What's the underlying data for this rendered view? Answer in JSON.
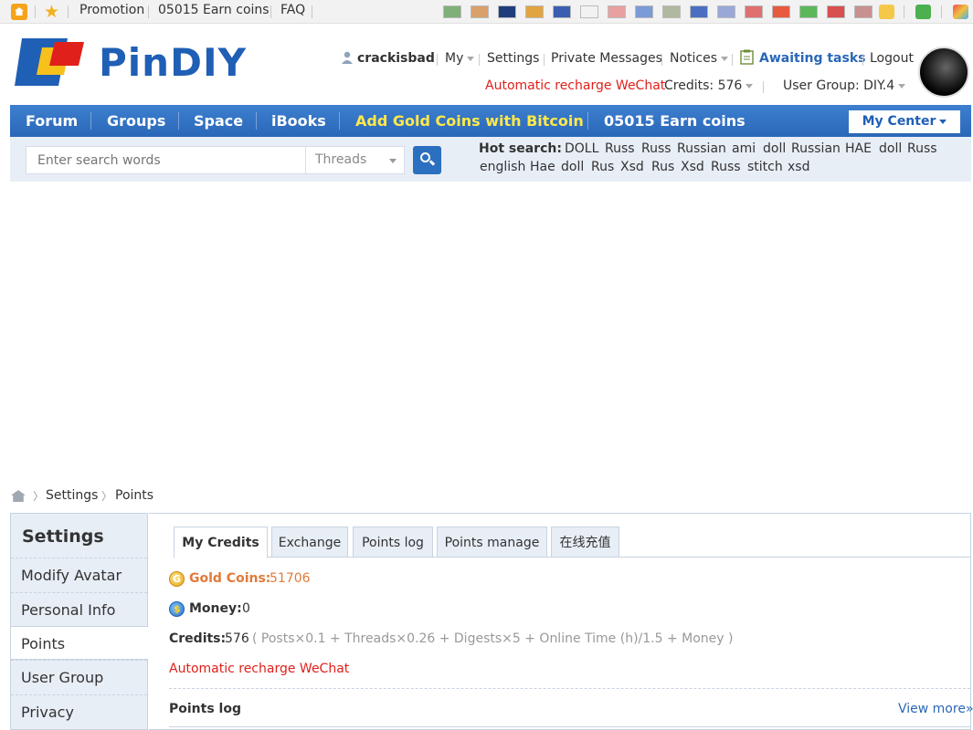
{
  "topbar": {
    "links": [
      "Promotion",
      "05015 Earn coins",
      "FAQ"
    ],
    "icons": [
      "home-icon",
      "star-icon",
      "glasses-icon",
      "recycle-icon",
      "app-icon"
    ],
    "flags": [
      {
        "name": "flag-icon",
        "color": "#7fb07a"
      },
      {
        "name": "flag-icon",
        "color": "#d9a06a"
      },
      {
        "name": "flag-icon",
        "color": "#1f3d7a"
      },
      {
        "name": "flag-icon",
        "color": "#e2a440"
      },
      {
        "name": "flag-icon",
        "color": "#3a5fb0"
      },
      {
        "name": "flag-icon",
        "color": "#f2f2f2"
      },
      {
        "name": "flag-icon",
        "color": "#e8a0a0"
      },
      {
        "name": "flag-icon",
        "color": "#7a9ad8"
      },
      {
        "name": "flag-icon",
        "color": "#b0b8a0"
      },
      {
        "name": "flag-icon",
        "color": "#4a6fc0"
      },
      {
        "name": "flag-icon",
        "color": "#9aa8d8"
      },
      {
        "name": "flag-icon",
        "color": "#e07070"
      },
      {
        "name": "flag-icon",
        "color": "#e85a40"
      },
      {
        "name": "flag-icon",
        "color": "#5ab85a"
      },
      {
        "name": "flag-icon",
        "color": "#d85050"
      },
      {
        "name": "flag-icon",
        "color": "#c89090"
      }
    ]
  },
  "header": {
    "logo_text": "PinDIY",
    "username": "crackisbad",
    "my_label": "My",
    "settings_label": "Settings",
    "pm_label": "Private Messages",
    "notices_label": "Notices",
    "tasks_label": "Awaiting tasks",
    "logout_label": "Logout",
    "recharge_label": "Automatic recharge WeChat",
    "credits_label": "Credits: 576",
    "usergroup_label": "User Group: DIY.4"
  },
  "nav": {
    "items": [
      "Forum",
      "Groups",
      "Space",
      "iBooks",
      "Add Gold Coins with Bitcoin",
      "05015 Earn coins"
    ],
    "my_center": "My Center"
  },
  "search": {
    "placeholder": "Enter search words",
    "type": "Threads",
    "hot_label": "Hot search:",
    "hot_words": [
      "DOLL",
      "Russ",
      "Russ",
      "Russian",
      "ami",
      "doll",
      "Russian",
      "HAE",
      "doll",
      "Russ",
      "english",
      "Hae",
      "doll",
      "Rus",
      "Xsd",
      "Rus",
      "Xsd",
      "Russ",
      "stitch",
      "xsd"
    ]
  },
  "breadcrumb": [
    "Settings",
    "Points"
  ],
  "sidebar": {
    "title": "Settings",
    "items": [
      "Modify Avatar",
      "Personal Info",
      "Points",
      "User Group",
      "Privacy"
    ]
  },
  "tabs": [
    "My Credits",
    "Exchange",
    "Points log",
    "Points manage",
    "在线充值"
  ],
  "credits": {
    "gold_label": "Gold Coins:",
    "gold_value": "51706",
    "money_label": "Money:",
    "money_value": "0",
    "credits_label": "Credits:",
    "credits_value": "576",
    "formula": "( Posts×0.1 + Threads×0.26 + Digests×5 + Online Time (h)/1.5 + Money )",
    "recharge_link": "Automatic recharge WeChat"
  },
  "points_log": {
    "title": "Points log",
    "view_more": "View more»"
  },
  "colors": {
    "brand_blue": "#1f5fb5",
    "nav_gold": "#ffe94a",
    "link_red": "#e0201a",
    "gold_value": "#e07a3a"
  }
}
